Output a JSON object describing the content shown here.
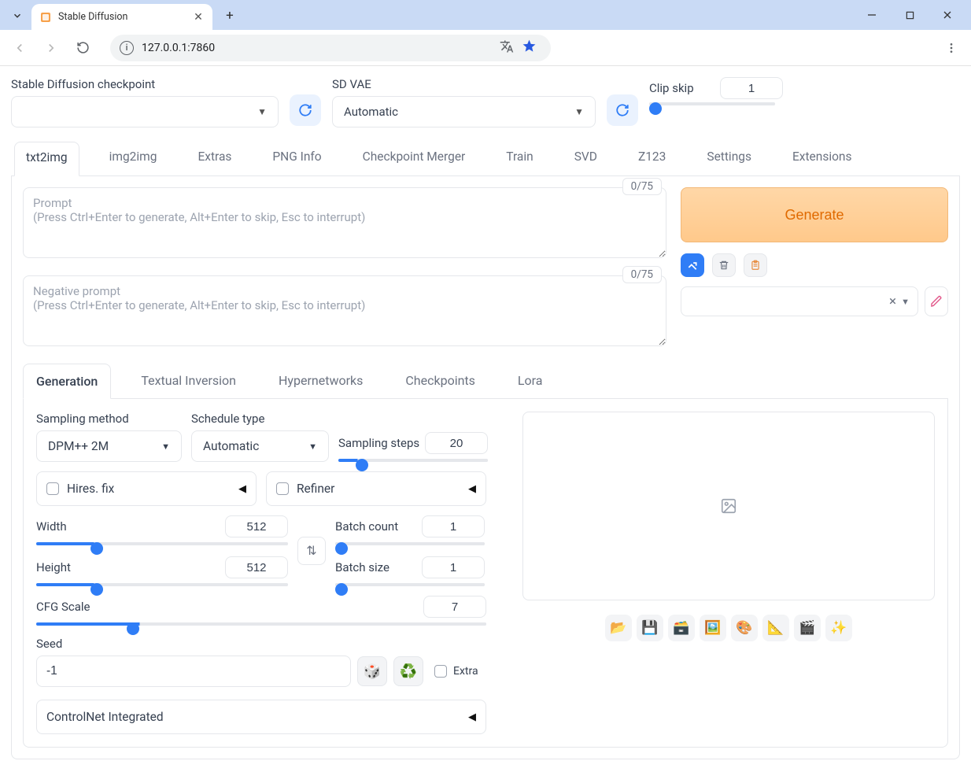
{
  "browser": {
    "tab_title": "Stable Diffusion",
    "url": "127.0.0.1:7860"
  },
  "top": {
    "checkpoint_label": "Stable Diffusion checkpoint",
    "checkpoint_value": "",
    "vae_label": "SD VAE",
    "vae_value": "Automatic",
    "clip_label": "Clip skip",
    "clip_value": "1"
  },
  "main_tabs": [
    "txt2img",
    "img2img",
    "Extras",
    "PNG Info",
    "Checkpoint Merger",
    "Train",
    "SVD",
    "Z123",
    "Settings",
    "Extensions"
  ],
  "prompt": {
    "counter": "0/75",
    "placeholder": "Prompt\n(Press Ctrl+Enter to generate, Alt+Enter to skip, Esc to interrupt)"
  },
  "neg_prompt": {
    "counter": "0/75",
    "placeholder": "Negative prompt\n(Press Ctrl+Enter to generate, Alt+Enter to skip, Esc to interrupt)"
  },
  "generate_label": "Generate",
  "style_clear": "×",
  "sub_tabs": [
    "Generation",
    "Textual Inversion",
    "Hypernetworks",
    "Checkpoints",
    "Lora"
  ],
  "gen": {
    "sampling_method_label": "Sampling method",
    "sampling_method_value": "DPM++ 2M",
    "schedule_label": "Schedule type",
    "schedule_value": "Automatic",
    "steps_label": "Sampling steps",
    "steps_value": "20",
    "hires_label": "Hires. fix",
    "refiner_label": "Refiner",
    "width_label": "Width",
    "width_value": "512",
    "height_label": "Height",
    "height_value": "512",
    "batch_count_label": "Batch count",
    "batch_count_value": "1",
    "batch_size_label": "Batch size",
    "batch_size_value": "1",
    "cfg_label": "CFG Scale",
    "cfg_value": "7",
    "seed_label": "Seed",
    "seed_value": "-1",
    "extra_label": "Extra",
    "controlnet_label": "ControlNet Integrated"
  },
  "preview_icons": [
    "📂",
    "💾",
    "🗃️",
    "🖼️",
    "🎨",
    "📐",
    "🎬",
    "✨"
  ]
}
